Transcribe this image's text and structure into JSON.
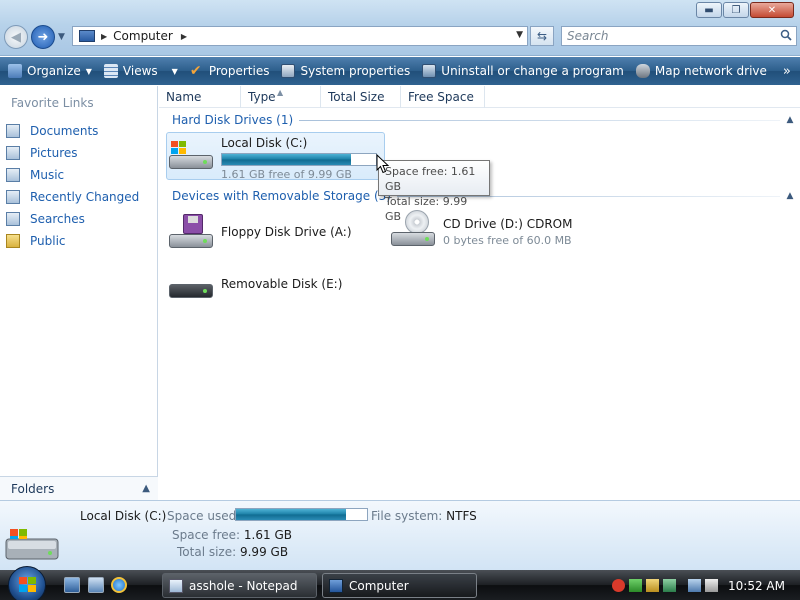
{
  "window": {
    "minimize_glyph": "▬",
    "maximize_glyph": "❐",
    "close_glyph": "✕"
  },
  "address": {
    "path": "Computer",
    "search_placeholder": "Search"
  },
  "toolbar": {
    "organize": "Organize",
    "views": "Views",
    "properties": "Properties",
    "system_properties": "System properties",
    "uninstall": "Uninstall or change a program",
    "map_network": "Map network drive",
    "more": "»"
  },
  "sidebar": {
    "title": "Favorite Links",
    "items": [
      {
        "label": "Documents",
        "icon": "documents-icon"
      },
      {
        "label": "Pictures",
        "icon": "pictures-icon"
      },
      {
        "label": "Music",
        "icon": "music-icon"
      },
      {
        "label": "Recently Changed",
        "icon": "recently-changed-icon"
      },
      {
        "label": "Searches",
        "icon": "searches-icon"
      },
      {
        "label": "Public",
        "icon": "folder-icon"
      }
    ],
    "folders": "Folders"
  },
  "columns": [
    "Name",
    "Type",
    "Total Size",
    "Free Space"
  ],
  "groups": {
    "hard_disk": "Hard Disk Drives (1)",
    "removable": "Devices with Removable Storage (3)"
  },
  "drives": {
    "c": {
      "name": "Local Disk (C:)",
      "sub": "1.61 GB free of 9.99 GB",
      "used_fraction": 0.84
    },
    "a": {
      "name": "Floppy Disk Drive (A:)"
    },
    "d": {
      "name": "CD Drive (D:) CDROM",
      "sub": "0 bytes free of 60.0 MB"
    },
    "e": {
      "name": "Removable Disk (E:)"
    }
  },
  "tooltip": {
    "line1": "Space free: 1.61 GB",
    "line2": "Total size: 9.99 GB"
  },
  "details": {
    "name": "Local Disk (C:)",
    "space_used_label": "Space used:",
    "space_used_fraction": 0.84,
    "file_system_label": "File system:",
    "file_system": "NTFS",
    "space_free_label": "Space free:",
    "space_free": "1.61 GB",
    "total_size_label": "Total size:",
    "total_size": "9.99 GB"
  },
  "taskbar": {
    "items": [
      {
        "label": "asshole - Notepad"
      },
      {
        "label": "Computer"
      }
    ],
    "clock": "10:52 AM"
  },
  "colors": {
    "link": "#1e5fae",
    "commandbar": "#2c5e8b",
    "progress": "#1a7ea6"
  }
}
